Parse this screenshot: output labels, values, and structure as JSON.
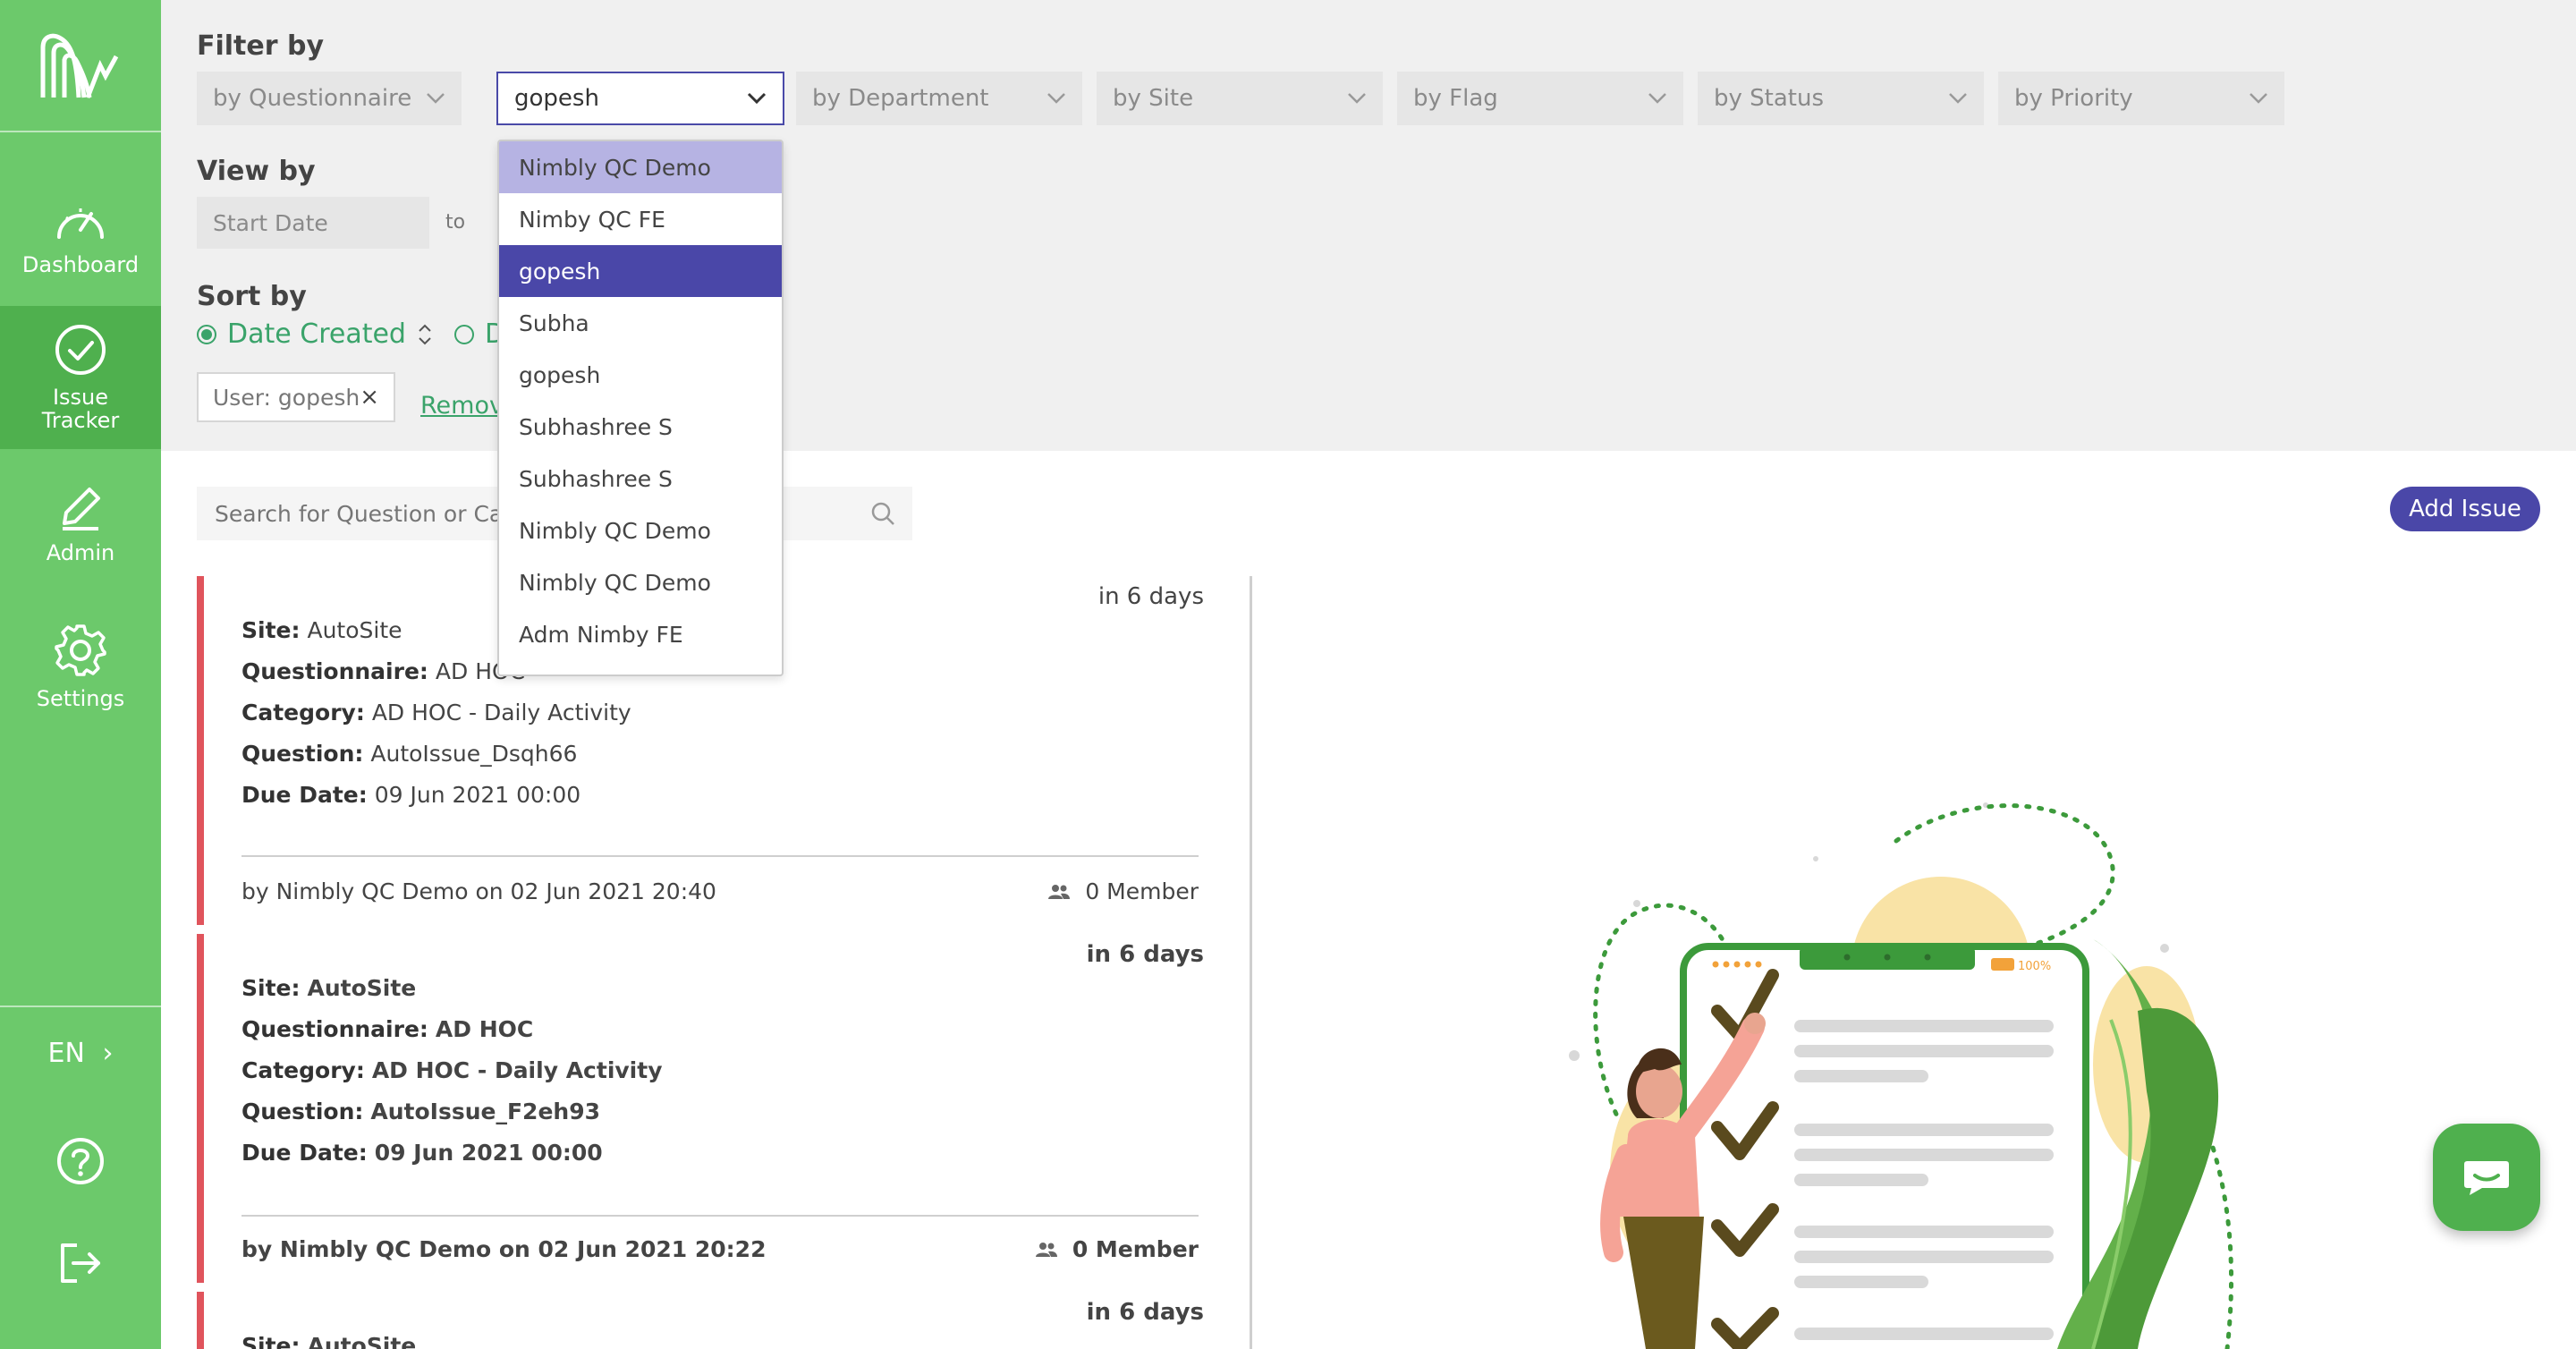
{
  "sidebar": {
    "items": [
      {
        "label": "Dashboard",
        "icon": "dashboard-gauge-icon"
      },
      {
        "label": "Issue\nTracker",
        "label_line1": "Issue",
        "label_line2": "Tracker",
        "icon": "check-circle-icon",
        "active": true
      },
      {
        "label": "Admin",
        "icon": "pencil-icon"
      },
      {
        "label": "Settings",
        "icon": "gear-icon"
      }
    ],
    "language": "EN",
    "help_icon": "question-circle-icon",
    "logout_icon": "logout-icon"
  },
  "filter": {
    "title": "Filter by",
    "questionnaire_placeholder": "by Questionnaire",
    "user_value": "gopesh",
    "department_placeholder": "by Department",
    "site_placeholder": "by Site",
    "flag_placeholder": "by Flag",
    "status_placeholder": "by Status",
    "priority_placeholder": "by Priority"
  },
  "view": {
    "title": "View by",
    "start_placeholder": "Start Date",
    "to_label": "to"
  },
  "sort": {
    "title": "Sort by",
    "option1": "Date Created",
    "option2_partial": "D"
  },
  "active_filter": {
    "chip_label": "User: gopesh",
    "close": "×",
    "remove_label": "Remov"
  },
  "search": {
    "placeholder": "Search for Question or Cat"
  },
  "add_issue_label": "Add Issue",
  "user_dropdown": {
    "options": [
      "Nimbly QC Demo",
      "Nimby QC FE",
      "gopesh",
      "Subha",
      "gopesh",
      "Subhashree S",
      "Subhashree S",
      "Nimbly QC Demo",
      "Nimbly QC Demo",
      "Adm Nimby FE"
    ],
    "hovered_index": 0,
    "selected_index": 2
  },
  "issues": [
    {
      "due_in": "in 6 days",
      "site_label": "Site:",
      "site": "AutoSite",
      "questionnaire_label": "Questionnaire:",
      "questionnaire": "AD HOC",
      "category_label": "Category:",
      "category": "AD HOC - Daily Activity",
      "question_label": "Question:",
      "question": "AutoIssue_Dsqh66",
      "due_label": "Due Date:",
      "due_date": "09 Jun 2021 00:00",
      "created_by": "by Nimbly QC Demo on 02 Jun 2021 20:40",
      "members": "0 Member"
    },
    {
      "due_in": "in 6 days",
      "site_label": "Site:",
      "site": "AutoSite",
      "questionnaire_label": "Questionnaire:",
      "questionnaire": "AD HOC",
      "category_label": "Category:",
      "category": "AD HOC - Daily Activity",
      "question_label": "Question:",
      "question": "AutoIssue_F2eh93",
      "due_label": "Due Date:",
      "due_date": "09 Jun 2021 00:00",
      "created_by": "by Nimbly QC Demo on 02 Jun 2021 20:22",
      "members": "0 Member"
    },
    {
      "due_in": "in 6 days",
      "site_label": "Site:",
      "site": "AutoSite"
    }
  ],
  "illustration": {
    "phone_battery": "100%"
  },
  "colors": {
    "sidebar_green": "#6cc96b",
    "active_green": "#4fb04e",
    "accent_purple": "#4a47a8",
    "issue_flag_red": "#e0545c",
    "sort_green": "#3aa36a"
  },
  "chat_icon": "chat-bubble-icon"
}
